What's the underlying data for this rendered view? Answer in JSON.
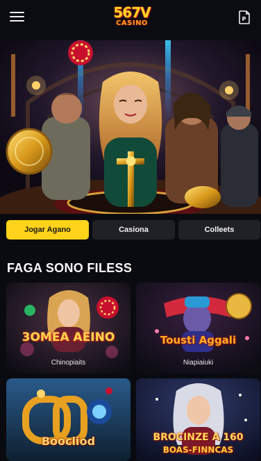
{
  "header": {
    "logo_main": "567V",
    "logo_sub": "CASINO"
  },
  "tabs": [
    {
      "label": "Jogar Agano"
    },
    {
      "label": "Casiona"
    },
    {
      "label": "Colleets"
    }
  ],
  "section": {
    "title": "FAGA SONO FILESS"
  },
  "games": [
    {
      "title": "3OMEA AEINO",
      "subtitle": "Chinopiaits"
    },
    {
      "title": "Tousti Aggali",
      "subtitle": "Niapiaiuki"
    },
    {
      "title": "Boocliod",
      "subtitle": ""
    },
    {
      "title": "BROCINZE A 160",
      "title2": "BOAS-FINNCAS",
      "subtitle": ""
    }
  ],
  "colors": {
    "accent": "#ffd31a",
    "background": "#0a0b10",
    "tab_inactive": "#202126"
  }
}
